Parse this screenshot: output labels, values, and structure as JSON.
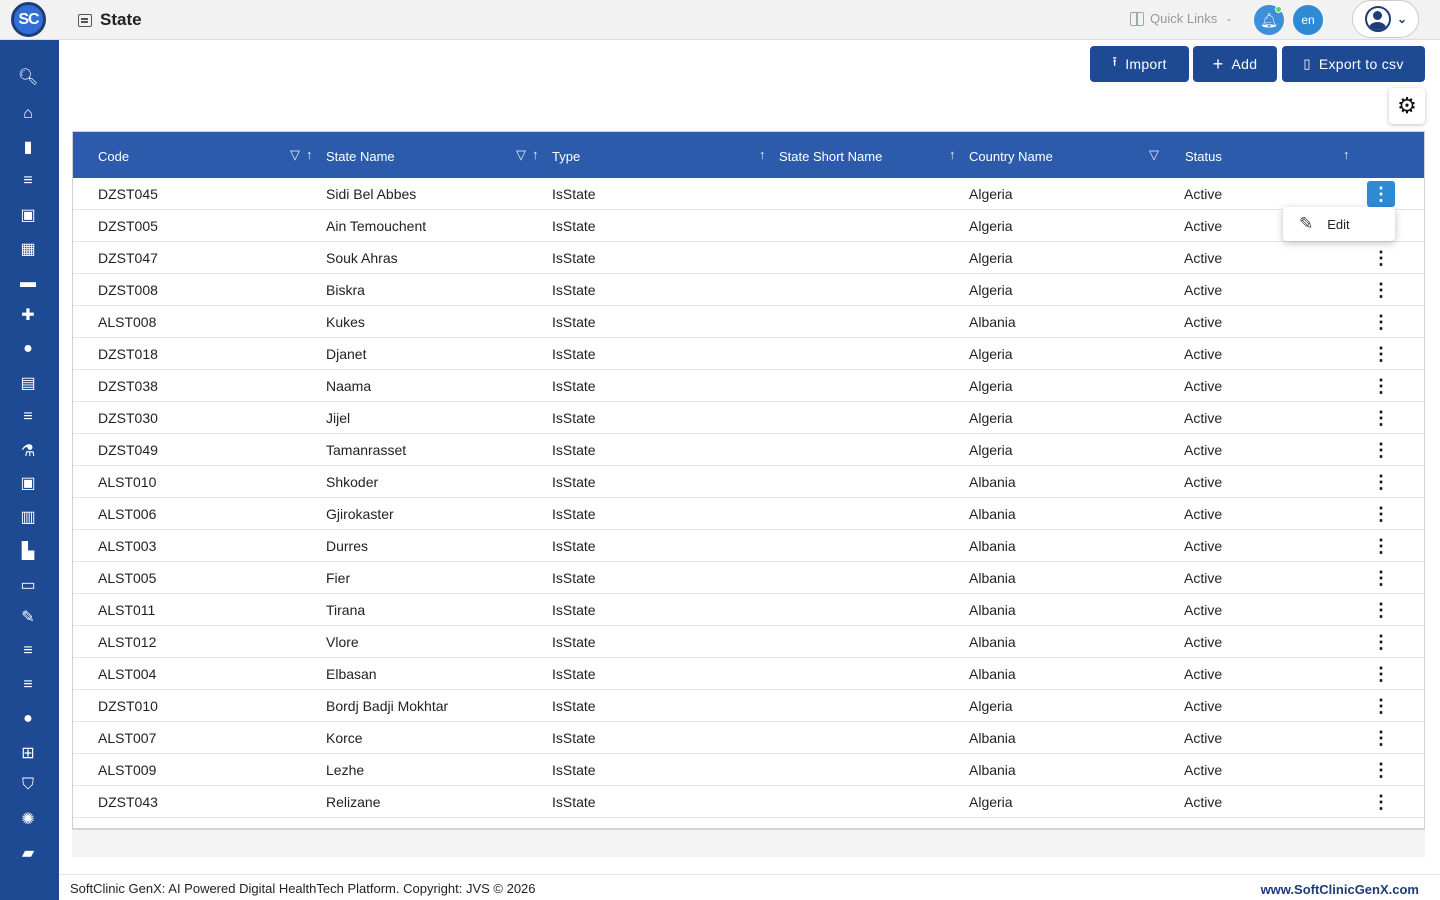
{
  "app": {
    "logo_text": "SC",
    "page_title": "State",
    "quick_links_label": "Quick Links",
    "language": "en"
  },
  "sidebar": {
    "items": [
      {
        "icon": "search-icon",
        "glyph": "🔍︎"
      },
      {
        "icon": "home-icon",
        "glyph": "⌂"
      },
      {
        "icon": "bar-chart-icon",
        "glyph": "▮"
      },
      {
        "icon": "menu-list-icon",
        "glyph": "≡"
      },
      {
        "icon": "medical-bag-icon",
        "glyph": "▣"
      },
      {
        "icon": "calendar-icon",
        "glyph": "▦"
      },
      {
        "icon": "bed-icon",
        "glyph": "▬"
      },
      {
        "icon": "medical-plus-icon",
        "glyph": "✚"
      },
      {
        "icon": "person-icon",
        "glyph": "●"
      },
      {
        "icon": "receipt-icon",
        "glyph": "▤"
      },
      {
        "icon": "menu-list-icon",
        "glyph": "≡"
      },
      {
        "icon": "lab-icon",
        "glyph": "⚗"
      },
      {
        "icon": "medicine-box-icon",
        "glyph": "▣"
      },
      {
        "icon": "book-icon",
        "glyph": "▥"
      },
      {
        "icon": "building-icon",
        "glyph": "▙"
      },
      {
        "icon": "devices-icon",
        "glyph": "▭"
      },
      {
        "icon": "wrench-icon",
        "glyph": "✎"
      },
      {
        "icon": "menu-list-icon",
        "glyph": "≡"
      },
      {
        "icon": "menu-list-icon",
        "glyph": "≡"
      },
      {
        "icon": "blood-drop-icon",
        "glyph": "●"
      },
      {
        "icon": "library-add-icon",
        "glyph": "⊞"
      },
      {
        "icon": "shield-icon",
        "glyph": "⛉"
      },
      {
        "icon": "hub-icon",
        "glyph": "✺"
      },
      {
        "icon": "folder-icon",
        "glyph": "▰"
      }
    ]
  },
  "toolbar": {
    "import_label": "Import",
    "add_label": "Add",
    "export_label": "Export to csv"
  },
  "table": {
    "columns": [
      "Code",
      "State Name",
      "Type",
      "State Short Name",
      "Country Name",
      "Status"
    ],
    "rows": [
      {
        "code": "DZST045",
        "state_name": "Sidi Bel Abbes",
        "type": "IsState",
        "short_name": "",
        "country": "Algeria",
        "status": "Active"
      },
      {
        "code": "DZST005",
        "state_name": "Ain Temouchent",
        "type": "IsState",
        "short_name": "",
        "country": "Algeria",
        "status": "Active"
      },
      {
        "code": "DZST047",
        "state_name": "Souk Ahras",
        "type": "IsState",
        "short_name": "",
        "country": "Algeria",
        "status": "Active"
      },
      {
        "code": "DZST008",
        "state_name": "Biskra",
        "type": "IsState",
        "short_name": "",
        "country": "Algeria",
        "status": "Active"
      },
      {
        "code": "ALST008",
        "state_name": "Kukes",
        "type": "IsState",
        "short_name": "",
        "country": "Albania",
        "status": "Active"
      },
      {
        "code": "DZST018",
        "state_name": "Djanet",
        "type": "IsState",
        "short_name": "",
        "country": "Algeria",
        "status": "Active"
      },
      {
        "code": "DZST038",
        "state_name": "Naama",
        "type": "IsState",
        "short_name": "",
        "country": "Algeria",
        "status": "Active"
      },
      {
        "code": "DZST030",
        "state_name": "Jijel",
        "type": "IsState",
        "short_name": "",
        "country": "Algeria",
        "status": "Active"
      },
      {
        "code": "DZST049",
        "state_name": "Tamanrasset",
        "type": "IsState",
        "short_name": "",
        "country": "Algeria",
        "status": "Active"
      },
      {
        "code": "ALST010",
        "state_name": "Shkoder",
        "type": "IsState",
        "short_name": "",
        "country": "Albania",
        "status": "Active"
      },
      {
        "code": "ALST006",
        "state_name": "Gjirokaster",
        "type": "IsState",
        "short_name": "",
        "country": "Albania",
        "status": "Active"
      },
      {
        "code": "ALST003",
        "state_name": "Durres",
        "type": "IsState",
        "short_name": "",
        "country": "Albania",
        "status": "Active"
      },
      {
        "code": "ALST005",
        "state_name": "Fier",
        "type": "IsState",
        "short_name": "",
        "country": "Albania",
        "status": "Active"
      },
      {
        "code": "ALST011",
        "state_name": "Tirana",
        "type": "IsState",
        "short_name": "",
        "country": "Albania",
        "status": "Active"
      },
      {
        "code": "ALST012",
        "state_name": "Vlore",
        "type": "IsState",
        "short_name": "",
        "country": "Albania",
        "status": "Active"
      },
      {
        "code": "ALST004",
        "state_name": "Elbasan",
        "type": "IsState",
        "short_name": "",
        "country": "Albania",
        "status": "Active"
      },
      {
        "code": "DZST010",
        "state_name": "Bordj Badji Mokhtar",
        "type": "IsState",
        "short_name": "",
        "country": "Algeria",
        "status": "Active"
      },
      {
        "code": "ALST007",
        "state_name": "Korce",
        "type": "IsState",
        "short_name": "",
        "country": "Albania",
        "status": "Active"
      },
      {
        "code": "ALST009",
        "state_name": "Lezhe",
        "type": "IsState",
        "short_name": "",
        "country": "Albania",
        "status": "Active"
      },
      {
        "code": "DZST043",
        "state_name": "Relizane",
        "type": "IsState",
        "short_name": "",
        "country": "Algeria",
        "status": "Active"
      }
    ]
  },
  "context_menu": {
    "edit_label": "Edit"
  },
  "footer": {
    "left_text": "SoftClinic GenX: AI Powered Digital HealthTech Platform. Copyright: JVS © 2026",
    "right_text": "www.SoftClinicGenX.com"
  },
  "colors": {
    "brand_dark": "#1e4a94",
    "table_header": "#2d5bab",
    "accent_blue": "#2f8ad6"
  }
}
